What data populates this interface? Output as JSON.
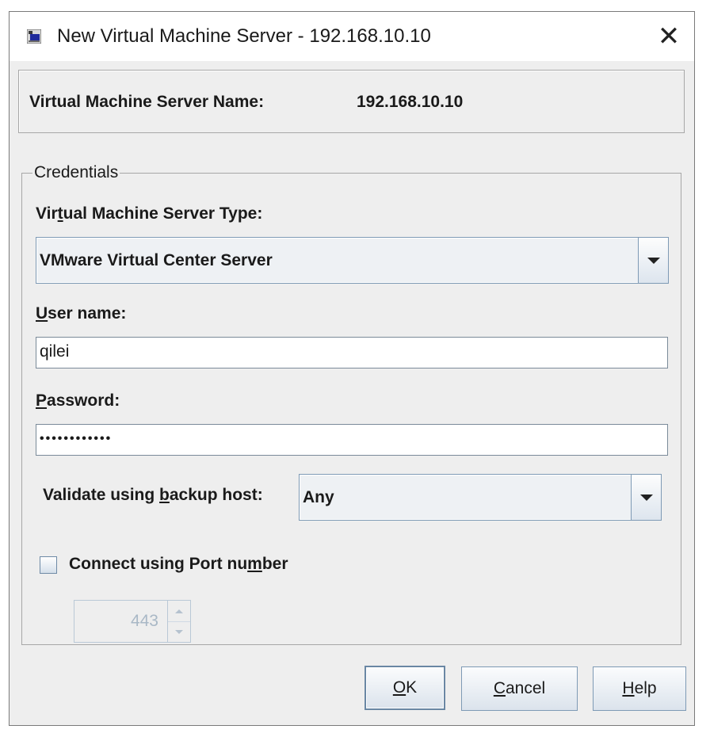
{
  "window": {
    "title": "New Virtual Machine Server - 192.168.10.10",
    "close_glyph": "✕"
  },
  "server": {
    "name_label": "Virtual Machine Server Name:",
    "name_value": "192.168.10.10"
  },
  "credentials": {
    "legend": "Credentials",
    "server_type_label_pre": "Vir",
    "server_type_label_mn": "t",
    "server_type_label_post": "ual Machine Server Type:",
    "server_type_value": "VMware Virtual Center Server",
    "username_label_mn": "U",
    "username_label_post": "ser name:",
    "username_value": "qilei",
    "password_label_mn": "P",
    "password_label_post": "assword:",
    "password_mask": "••••••••••••",
    "backup_label_pre": "Validate using ",
    "backup_label_mn": "b",
    "backup_label_post": "ackup host:",
    "backup_value": "Any",
    "port_check_pre": "Connect using Port nu",
    "port_check_mn": "m",
    "port_check_post": "ber",
    "port_checked": false,
    "port_value": "443"
  },
  "buttons": {
    "ok_mn": "O",
    "ok_post": "K",
    "cancel_mn": "C",
    "cancel_post": "ancel",
    "help_mn": "H",
    "help_post": "elp"
  },
  "icons": {
    "app": "java-window-icon",
    "close": "close-icon",
    "dropdown": "chevron-down-icon"
  },
  "colors": {
    "dialog_bg": "#eeeeee",
    "control_border": "#7e9ab5",
    "disabled_text": "#a9b8c6"
  }
}
